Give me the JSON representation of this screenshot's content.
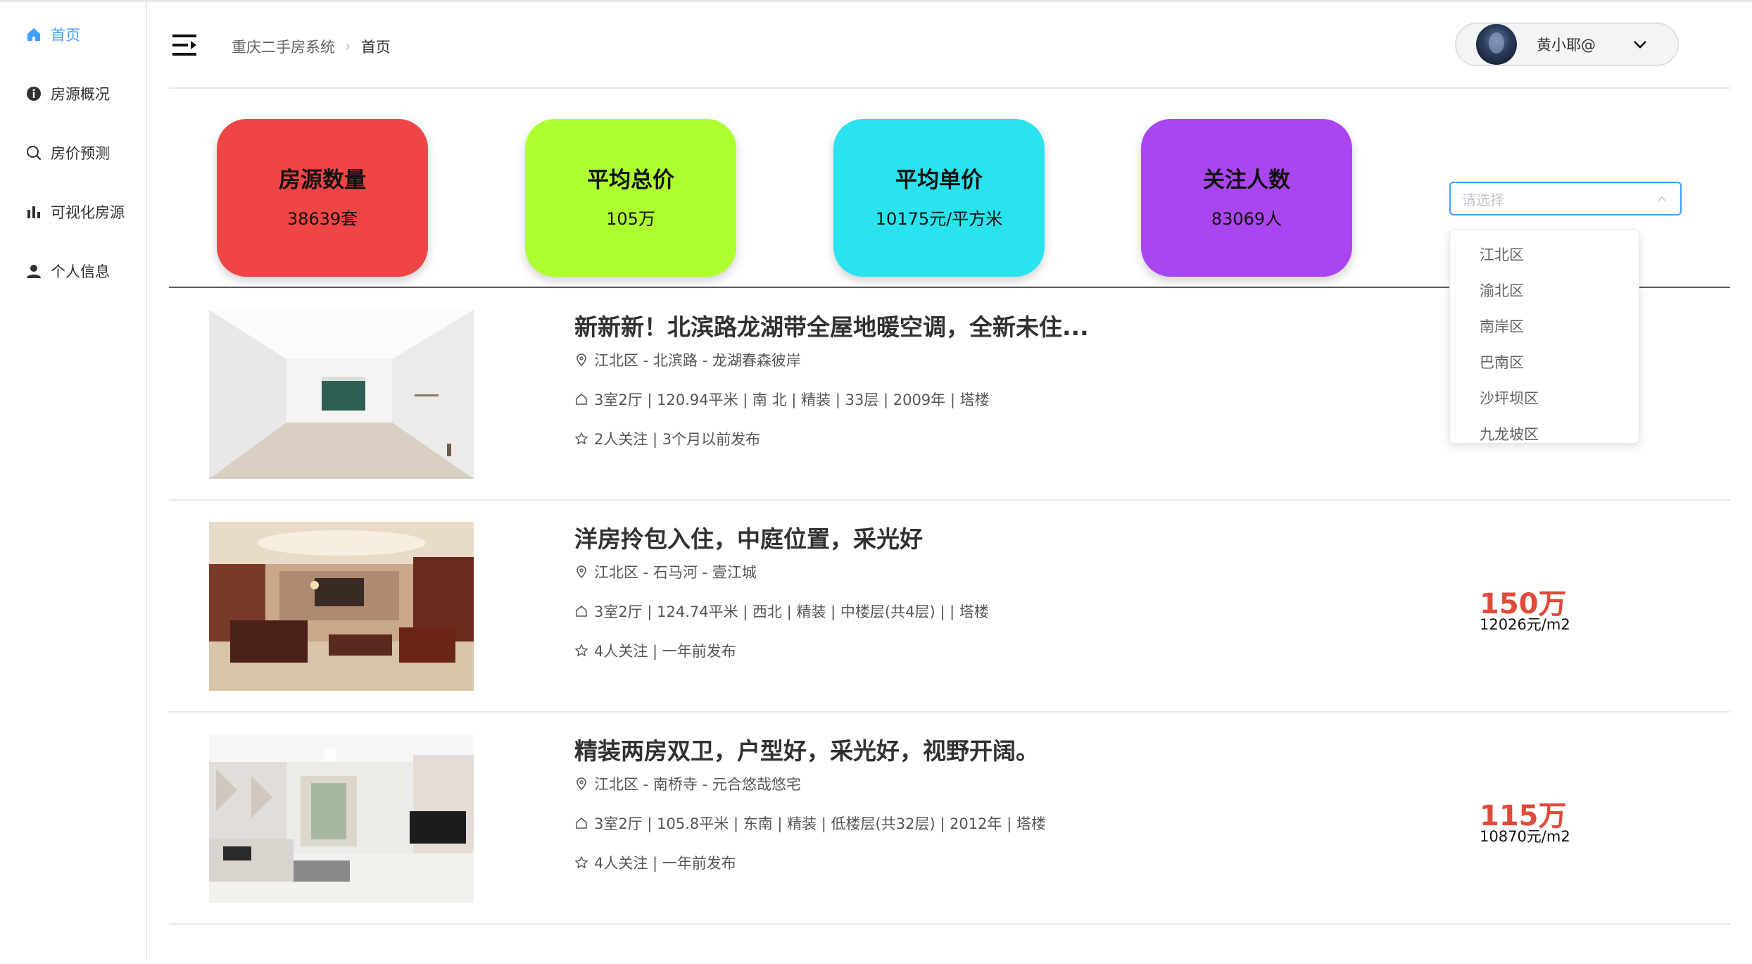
{
  "sidebar": {
    "items": [
      {
        "label": "首页",
        "icon": "home-icon",
        "active": true
      },
      {
        "label": "房源概况",
        "icon": "info-icon"
      },
      {
        "label": "房价预测",
        "icon": "search-icon"
      },
      {
        "label": "可视化房源",
        "icon": "bar-chart-icon"
      },
      {
        "label": "个人信息",
        "icon": "user-icon"
      }
    ]
  },
  "header": {
    "breadcrumb": [
      "重庆二手房系统",
      "首页"
    ],
    "user_name": "黄小耶@"
  },
  "stats": [
    {
      "title": "房源数量",
      "value": "38639套",
      "color": "#ef4545"
    },
    {
      "title": "平均总价",
      "value": "105万",
      "color": "#adff2f"
    },
    {
      "title": "平均单价",
      "value": "10175元/平方米",
      "color": "#2ae3ee"
    },
    {
      "title": "关注人数",
      "value": "83069人",
      "color": "#aa46ef"
    }
  ],
  "district_select": {
    "placeholder": "请选择",
    "options": [
      "江北区",
      "渝北区",
      "南岸区",
      "巴南区",
      "沙坪坝区",
      "九龙坡区"
    ]
  },
  "listings": [
    {
      "title": "新新新！北滨路龙湖带全屋地暖空调，全新未住...",
      "location": "江北区 - 北滨路 - 龙湖春森彼岸",
      "specs": "3室2厅 | 120.94平米 | 南 北 | 精装 | 33层 | 2009年 | 塔楼",
      "meta": "2人关注 | 3个月以前发布",
      "price": "",
      "unit_price": ""
    },
    {
      "title": "洋房拎包入住，中庭位置，采光好",
      "location": "江北区 - 石马河 - 壹江城",
      "specs": "3室2厅 | 124.74平米 | 西北 | 精装 | 中楼层(共4层) | | 塔楼",
      "meta": "4人关注 | 一年前发布",
      "price": "150万",
      "unit_price": "12026元/m2"
    },
    {
      "title": "精装两房双卫，户型好，采光好，视野开阔。",
      "location": "江北区 - 南桥寺 - 元合悠哉悠宅",
      "specs": "3室2厅 | 105.8平米 | 东南 | 精装 | 低楼层(共32层) | 2012年 | 塔楼",
      "meta": "4人关注 | 一年前发布",
      "price": "115万",
      "unit_price": "10870元/m2"
    }
  ]
}
